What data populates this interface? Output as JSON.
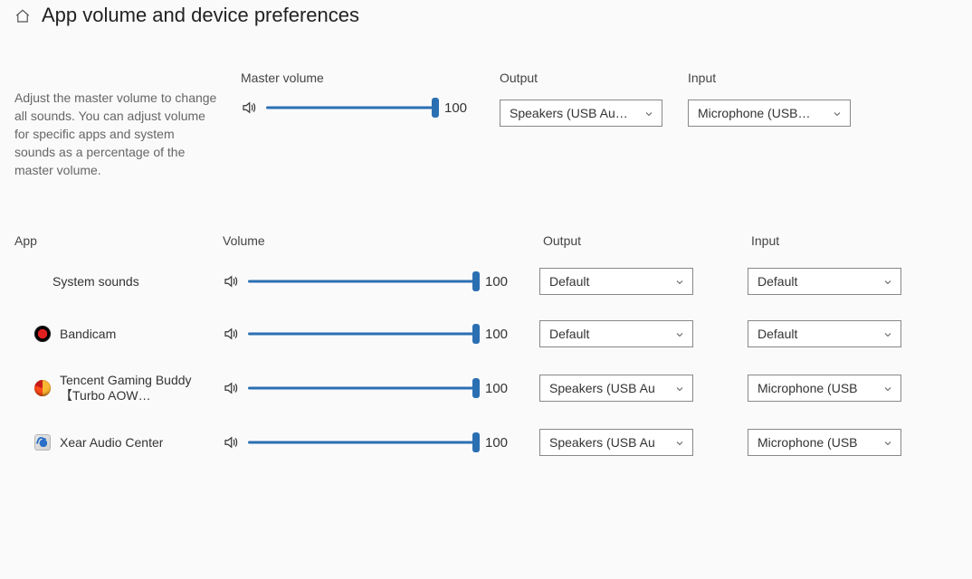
{
  "title": "App volume and device preferences",
  "master": {
    "description": "Adjust the master volume to change all sounds. You can adjust volume for specific apps and system sounds as a percentage of the master volume.",
    "volume_label": "Master volume",
    "volume": 100,
    "output_label": "Output",
    "output_value": "Speakers (USB Au…",
    "input_label": "Input",
    "input_value": "Microphone (USB…"
  },
  "cols": {
    "app": "App",
    "volume": "Volume",
    "output": "Output",
    "input": "Input"
  },
  "apps": [
    {
      "name": "System sounds",
      "icon": "none",
      "volume": 100,
      "output": "Default",
      "input": "Default"
    },
    {
      "name": "Bandicam",
      "icon": "bandicam",
      "volume": 100,
      "output": "Default",
      "input": "Default"
    },
    {
      "name": "Tencent Gaming Buddy【Turbo AOW…",
      "icon": "tencent",
      "volume": 100,
      "output": "Speakers (USB Au",
      "input": "Microphone (USB"
    },
    {
      "name": "Xear Audio Center",
      "icon": "xear",
      "volume": 100,
      "output": "Speakers (USB Au",
      "input": "Microphone (USB"
    }
  ]
}
